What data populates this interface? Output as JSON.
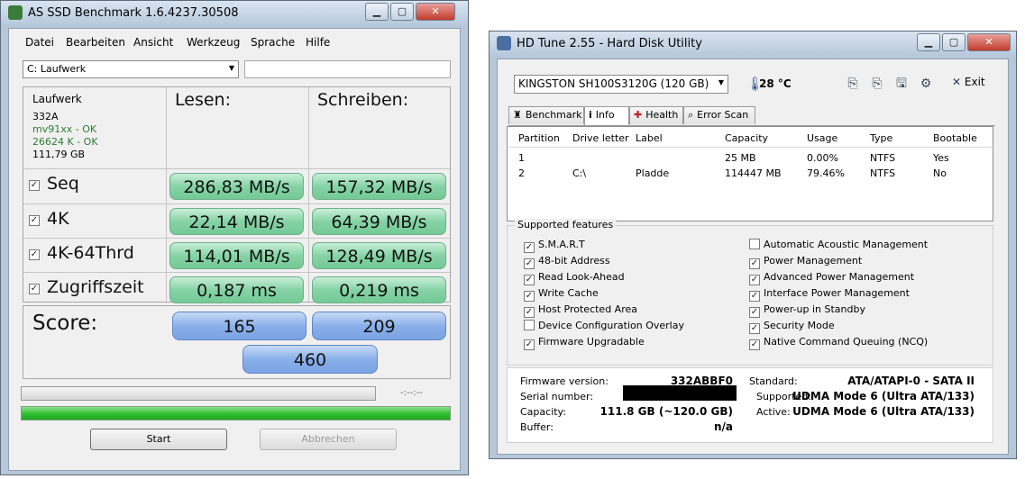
{
  "asssd": {
    "title": "AS SSD Benchmark 1.6.4237.30508",
    "menu": [
      "Datei",
      "Bearbeiten",
      "Ansicht",
      "Werkzeug",
      "Sprache",
      "Hilfe"
    ],
    "drive_select": "C: Laufwerk",
    "headers": {
      "drive": "Laufwerk",
      "read": "Lesen:",
      "write": "Schreiben:"
    },
    "drive_info": [
      "332A",
      "mv91xx - OK",
      "26624 K - OK",
      "111,79 GB"
    ],
    "ok_color": "#2e7d32",
    "rows": [
      {
        "label": "Seq",
        "read": "286,83 MB/s",
        "write": "157,32 MB/s"
      },
      {
        "label": "4K",
        "read": "22,14 MB/s",
        "write": "64,39 MB/s"
      },
      {
        "label": "4K-64Thrd",
        "read": "114,01 MB/s",
        "write": "128,49 MB/s"
      },
      {
        "label": "Zugriffszeit",
        "read": "0,187 ms",
        "write": "0,219 ms"
      }
    ],
    "score_label": "Score:",
    "score_read": "165",
    "score_write": "209",
    "score_total": "460",
    "time_text": "-:--:--",
    "progress_fraction": 1.0,
    "start_label": "Start",
    "abort_label": "Abbrechen"
  },
  "hdtune": {
    "title": "HD Tune 2.55 - Hard Disk Utility",
    "drive_select": "KINGSTON SH100S3120G (120 GB)",
    "temperature": "28 °C",
    "exit_label": "Exit",
    "tabs": [
      "Benchmark",
      "Info",
      "Health",
      "Error Scan"
    ],
    "active_tab": "Info",
    "partition_headers": [
      "Partition",
      "Drive letter",
      "Label",
      "Capacity",
      "Usage",
      "Type",
      "Bootable"
    ],
    "partitions": [
      [
        "1",
        "",
        "",
        "25 MB",
        "0.00%",
        "NTFS",
        "Yes"
      ],
      [
        "2",
        "C:\\",
        "Pladde",
        "114447 MB",
        "79.46%",
        "NTFS",
        "No"
      ]
    ],
    "features_title": "Supported features",
    "features_left": [
      {
        "label": "S.M.A.R.T",
        "checked": true
      },
      {
        "label": "48-bit Address",
        "checked": true
      },
      {
        "label": "Read Look-Ahead",
        "checked": true
      },
      {
        "label": "Write Cache",
        "checked": true
      },
      {
        "label": "Host Protected Area",
        "checked": true
      },
      {
        "label": "Device Configuration Overlay",
        "checked": false
      },
      {
        "label": "Firmware Upgradable",
        "checked": true
      }
    ],
    "features_right": [
      {
        "label": "Automatic Acoustic Management",
        "checked": false
      },
      {
        "label": "Power Management",
        "checked": true
      },
      {
        "label": "Advanced Power Management",
        "checked": true
      },
      {
        "label": "Interface Power Management",
        "checked": true
      },
      {
        "label": "Power-up in Standby",
        "checked": true
      },
      {
        "label": "Security Mode",
        "checked": true
      },
      {
        "label": "Native Command Queuing (NCQ)",
        "checked": true
      }
    ],
    "info": {
      "firmware_label": "Firmware version:",
      "firmware": "332ABBF0",
      "serial_label": "Serial number:",
      "capacity_label": "Capacity:",
      "capacity": "111.8 GB (~120.0 GB)",
      "buffer_label": "Buffer:",
      "buffer": "n/a",
      "standard_label": "Standard:",
      "standard": "ATA/ATAPI-0 - SATA II",
      "supported_label": "Supported:",
      "supported": "UDMA Mode 6 (Ultra ATA/133)",
      "active_label": "Active:",
      "active": "UDMA Mode 6 (Ultra ATA/133)"
    }
  }
}
